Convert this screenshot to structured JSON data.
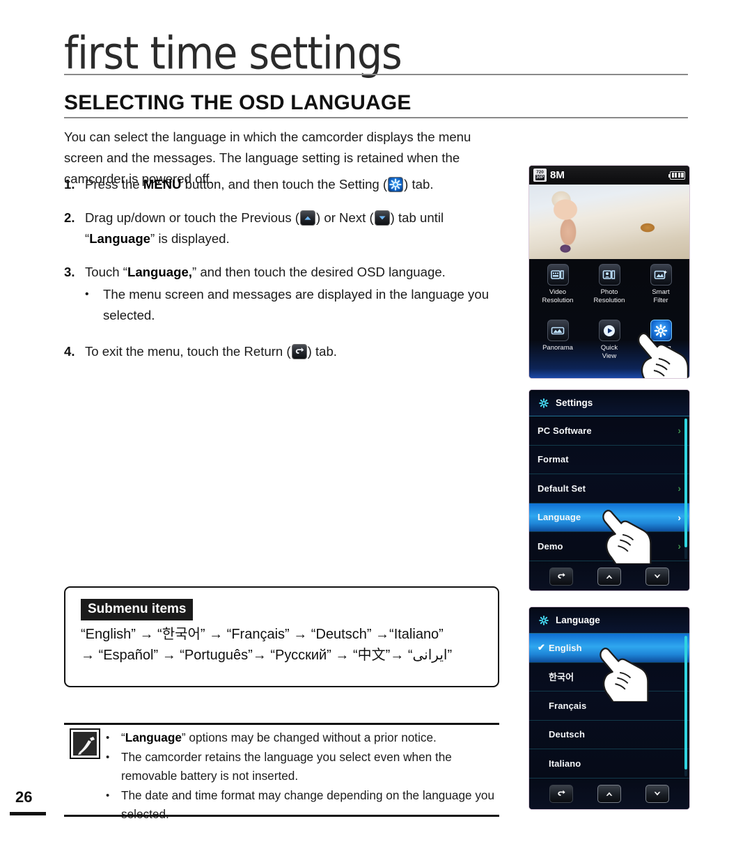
{
  "page": {
    "chapter_title": "first time settings",
    "section_title": "SELECTING THE OSD LANGUAGE",
    "intro": "You can select the language in which the camcorder displays the menu screen and the messages. The language setting is retained when the camcorder is powered off.",
    "page_number": "26"
  },
  "steps": [
    {
      "num": "1.",
      "text_before": "Press the ",
      "bold1": "MENU",
      "text_mid": " button, and then touch the Setting (",
      "icon": "setting-gear-icon",
      "text_after": ") tab."
    },
    {
      "num": "2.",
      "text_before": "Drag up/down or touch the Previous (",
      "icon1": "chevron-up-icon",
      "text_mid": ") or Next (",
      "icon2": "chevron-down-icon",
      "text_after": ") tab until",
      "line2_q1": "“",
      "bold1": "Language",
      "line2_q2": "” is displayed."
    },
    {
      "num": "3.",
      "text_before": "Touch “",
      "bold1": "Language,",
      "text_after": "” and then touch the desired OSD language.",
      "bullet": "The menu screen and messages are displayed in the language you selected."
    },
    {
      "num": "4.",
      "text_before": "To exit the menu, touch the Return (",
      "icon": "return-arrow-icon",
      "text_after": ") tab."
    }
  ],
  "submenu_box": {
    "label": "Submenu items",
    "line1": "“English” → “한국어” → “Français” → “Deutsch” →“Italiano”",
    "line2": "→ “Español” → “Português”→ “Русский” → “中文”→ “ايرانی”"
  },
  "notes": {
    "icon": "note-pen-icon",
    "items": [
      {
        "prefix": "“",
        "bold": "Language",
        "suffix": "” options may be changed without a prior notice."
      },
      {
        "prefix": "",
        "bold": "",
        "suffix": "The camcorder retains the language you select even when the removable battery is not inserted."
      },
      {
        "prefix": "",
        "bold": "",
        "suffix": "The date and time format may change depending on the language you selected."
      }
    ]
  },
  "device": {
    "home_screen": {
      "status": {
        "video_res_top": "720",
        "video_res_bottom": "30P",
        "photo_res": "8M",
        "battery_icon": "battery-full-icon",
        "battery_bars": 4
      },
      "preview_icon": "photo-preview-child-on-beach",
      "menu_items": [
        {
          "label": "Video\nResolution",
          "icon": "video-resolution-icon",
          "active": false
        },
        {
          "label": "Photo\nResolution",
          "icon": "photo-resolution-icon",
          "active": false
        },
        {
          "label": "Smart\nFilter",
          "icon": "smart-filter-icon",
          "active": false
        },
        {
          "label": "Panorama",
          "icon": "panorama-icon",
          "active": false
        },
        {
          "label": "Quick\nView",
          "icon": "quick-view-icon",
          "active": false
        },
        {
          "label": "Setting",
          "icon": "setting-gear-icon",
          "active": true
        }
      ],
      "hand_cursor": "hand-pointer-on-setting"
    },
    "settings_screen": {
      "title": "Settings",
      "title_icon": "gear-icon",
      "rows": [
        {
          "label": "PC Software",
          "chevron": "›",
          "selected": false,
          "checked": false
        },
        {
          "label": "Format",
          "chevron": "",
          "selected": false,
          "checked": false
        },
        {
          "label": "Default Set",
          "chevron": "›",
          "selected": false,
          "checked": false
        },
        {
          "label": "Language",
          "chevron": "›",
          "selected": true,
          "checked": false
        },
        {
          "label": "Demo",
          "chevron": "›",
          "selected": false,
          "checked": false
        }
      ],
      "hand_cursor": "hand-pointer-on-language",
      "footer": [
        {
          "icon": "return-arrow-icon",
          "name": "return-button"
        },
        {
          "icon": "chevron-up-icon",
          "name": "previous-button"
        },
        {
          "icon": "chevron-down-icon",
          "name": "next-button"
        }
      ]
    },
    "language_screen": {
      "title": "Language",
      "title_icon": "gear-icon",
      "rows": [
        {
          "label": "English",
          "selected": true,
          "checked": true
        },
        {
          "label": "한국어",
          "selected": false,
          "checked": false
        },
        {
          "label": "Français",
          "selected": false,
          "checked": false
        },
        {
          "label": "Deutsch",
          "selected": false,
          "checked": false
        },
        {
          "label": "Italiano",
          "selected": false,
          "checked": false
        }
      ],
      "check_glyph": "✔",
      "hand_cursor": "hand-pointer-on-english",
      "footer": [
        {
          "icon": "return-arrow-icon",
          "name": "return-button"
        },
        {
          "icon": "chevron-up-icon",
          "name": "previous-button"
        },
        {
          "icon": "chevron-down-icon",
          "name": "next-button"
        }
      ]
    }
  },
  "colors": {
    "accent_blue": "#2fa7ef",
    "menu_bg": "#060a16",
    "rule": "#111111"
  }
}
